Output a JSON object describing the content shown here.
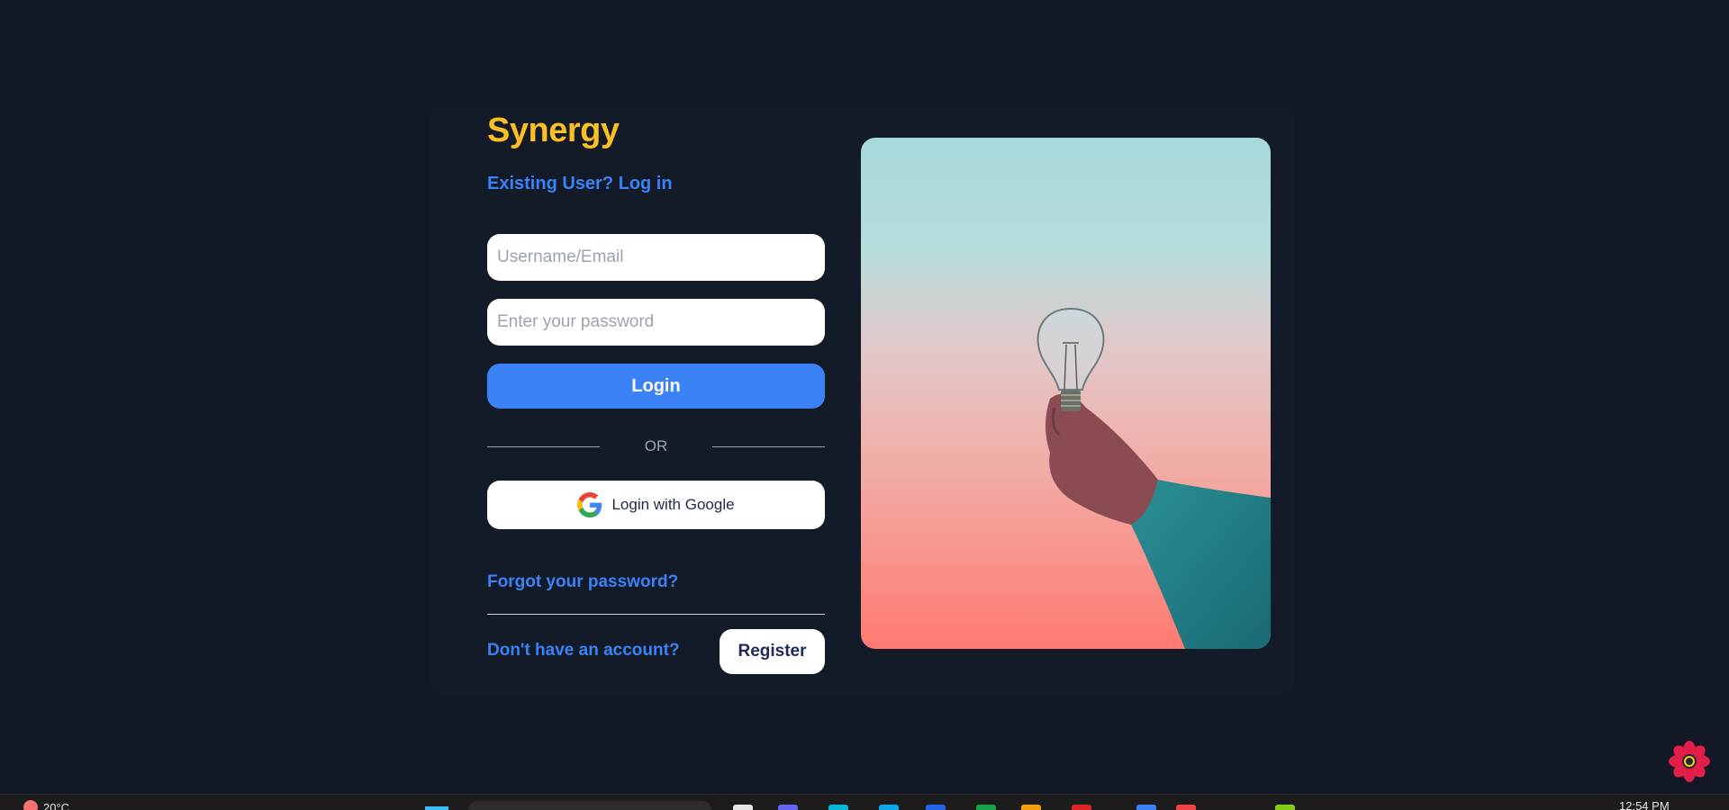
{
  "brand": {
    "name": "Synergy"
  },
  "form": {
    "subtitle": "Existing User? Log in",
    "username_placeholder": "Username/Email",
    "password_placeholder": "Enter your password",
    "login_label": "Login",
    "divider_text": "OR",
    "google_label": "Login with Google",
    "forgot_label": "Forgot your password?",
    "no_account_text": "Don't have an account?",
    "register_label": "Register"
  },
  "hero": {
    "icon": "lightbulb-in-hand-image"
  },
  "taskbar": {
    "weather": "20°C",
    "clock": "12:54 PM"
  },
  "colors": {
    "background": "#121826",
    "brand": "#fbbf24",
    "accent": "#3b82f6",
    "button_text_dark": "#1e2a5a"
  }
}
